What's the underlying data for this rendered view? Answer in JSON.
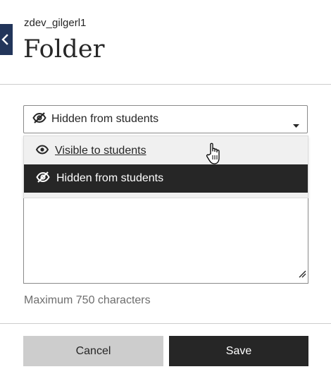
{
  "header": {
    "course_id": "zdev_gilgerl1",
    "title": "Folder"
  },
  "visibility_select": {
    "selected_label": "Hidden from students",
    "selected_icon": "eye-slash-icon",
    "options": [
      {
        "label": "Visible to students",
        "icon": "eye-icon",
        "state": "hovered"
      },
      {
        "label": "Hidden from students",
        "icon": "eye-slash-icon",
        "state": "selected"
      }
    ]
  },
  "description": {
    "hint": "Maximum 750 characters"
  },
  "footer": {
    "cancel_label": "Cancel",
    "save_label": "Save"
  },
  "colors": {
    "brand_navy": "#22355a",
    "dark": "#262626",
    "button_gray": "#cdcdcd",
    "menu_bg": "#f0f0f0"
  }
}
